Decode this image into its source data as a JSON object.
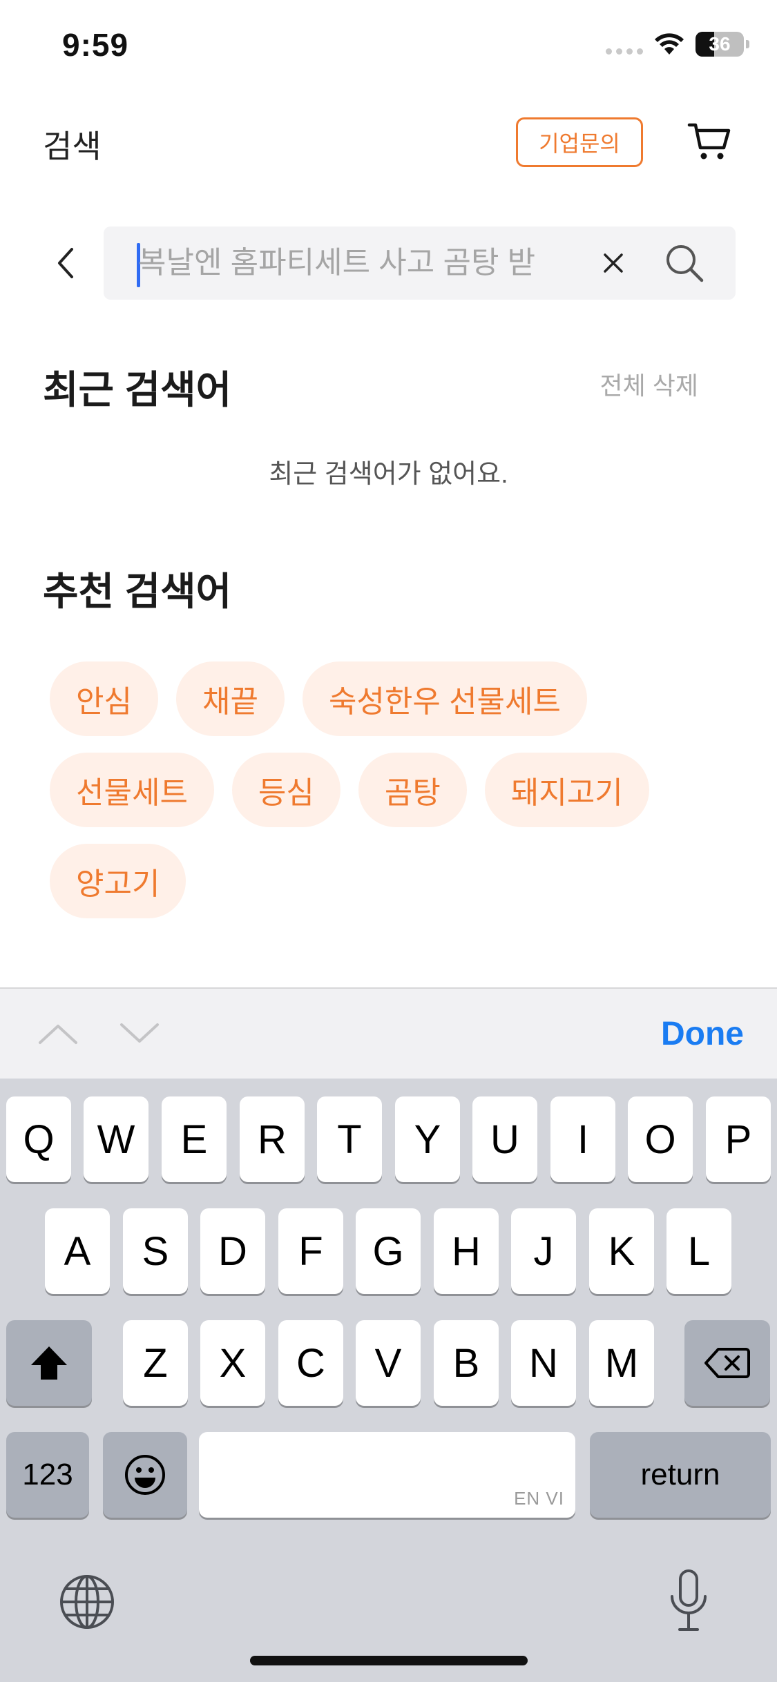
{
  "status_bar": {
    "time": "9:59",
    "battery": "36"
  },
  "header": {
    "title": "검색",
    "corp_button": "기업문의"
  },
  "search": {
    "placeholder": "복날엔 홈파티세트 사고 곰탕 받"
  },
  "recent": {
    "title": "최근 검색어",
    "delete_all": "전체 삭제",
    "empty_message": "최근 검색어가 없어요."
  },
  "recommended": {
    "title": "추천 검색어",
    "keywords": [
      "안심",
      "채끝",
      "숙성한우 선물세트",
      "선물세트",
      "등심",
      "곰탕",
      "돼지고기",
      "양고기"
    ]
  },
  "keyboard": {
    "toolbar_done": "Done",
    "row1": [
      "Q",
      "W",
      "E",
      "R",
      "T",
      "Y",
      "U",
      "I",
      "O",
      "P"
    ],
    "row2": [
      "A",
      "S",
      "D",
      "F",
      "G",
      "H",
      "J",
      "K",
      "L"
    ],
    "row3": [
      "Z",
      "X",
      "C",
      "V",
      "B",
      "N",
      "M"
    ],
    "numbers_key": "123",
    "return_key": "return",
    "space_sublabel": "EN VI"
  },
  "colors": {
    "accent": "#ef7a2f",
    "chip_bg": "#fff0e8",
    "done_blue": "#1a7cf2",
    "keyboard_bg": "#d3d5db"
  }
}
